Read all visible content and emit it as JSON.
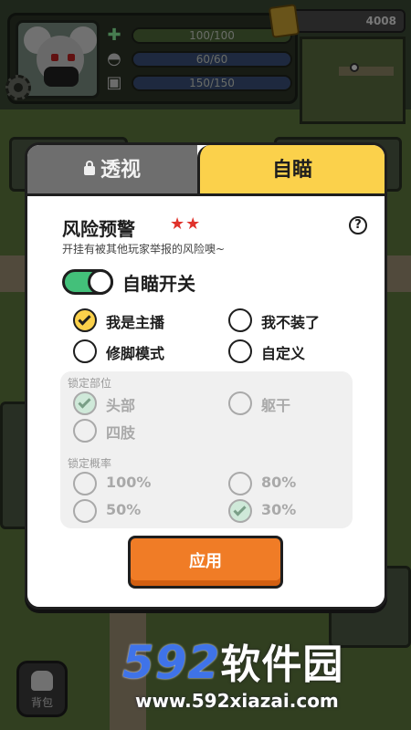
{
  "hud": {
    "hp": "100/100",
    "armor": "60/60",
    "stamina": "150/150",
    "coins": "4008",
    "bag_label": "背包"
  },
  "modal": {
    "tabs": [
      {
        "label": "透视",
        "locked": true,
        "active": false
      },
      {
        "label": "自瞄",
        "locked": false,
        "active": true
      }
    ],
    "risk_title": "风险预警",
    "risk_stars": "★★",
    "risk_desc": "开挂有被其他玩家举报的风险噢~",
    "help_icon": "?",
    "toggle_label": "自瞄开关",
    "toggle_on": true,
    "modes": [
      {
        "label": "我是主播",
        "checked": true
      },
      {
        "label": "我不装了",
        "checked": false
      },
      {
        "label": "修脚模式",
        "checked": false
      },
      {
        "label": "自定义",
        "checked": false
      }
    ],
    "lock_part_title": "锁定部位",
    "lock_parts": [
      {
        "label": "头部",
        "checked": true
      },
      {
        "label": "躯干",
        "checked": false
      },
      {
        "label": "四肢",
        "checked": false
      }
    ],
    "lock_rate_title": "锁定概率",
    "lock_rates": [
      {
        "label": "100%",
        "checked": false
      },
      {
        "label": "80%",
        "checked": false
      },
      {
        "label": "50%",
        "checked": false
      },
      {
        "label": "30%",
        "checked": true
      }
    ],
    "apply_label": "应用"
  },
  "watermark": {
    "logo_num": "592",
    "logo_cn": "软件园",
    "url": "www.592xiazai.com"
  },
  "colors": {
    "accent_yellow": "#fbd14b",
    "apply_orange": "#f07c26",
    "toggle_green": "#43c07a",
    "star_red": "#e0322b"
  }
}
